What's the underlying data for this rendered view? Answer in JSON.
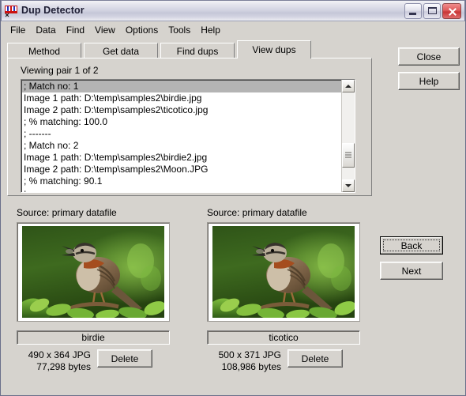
{
  "window": {
    "title": "Dup Detector",
    "icon": "dup-images-icon",
    "minimize_label": "Minimize",
    "maximize_label": "Maximize",
    "close_label": "Close"
  },
  "menu": {
    "items": [
      {
        "label": "File"
      },
      {
        "label": "Data"
      },
      {
        "label": "Find"
      },
      {
        "label": "View"
      },
      {
        "label": "Options"
      },
      {
        "label": "Tools"
      },
      {
        "label": "Help"
      }
    ]
  },
  "tabs": [
    {
      "label": "Method",
      "selected": false
    },
    {
      "label": "Get data",
      "selected": false
    },
    {
      "label": "Find dups",
      "selected": false
    },
    {
      "label": "View dups",
      "selected": true
    }
  ],
  "view_dups": {
    "viewing_label": "Viewing pair 1 of 2",
    "list": [
      {
        "text": "; Match no: 1",
        "selected": true
      },
      {
        "text": "Image 1 path: D:\\temp\\samples2\\birdie.jpg",
        "selected": false
      },
      {
        "text": "Image 2 path: D:\\temp\\samples2\\ticotico.jpg",
        "selected": false
      },
      {
        "text": "; % matching: 100.0",
        "selected": false
      },
      {
        "text": "; -------",
        "selected": false
      },
      {
        "text": "; Match no: 2",
        "selected": false
      },
      {
        "text": "Image 1 path: D:\\temp\\samples2\\birdie2.jpg",
        "selected": false
      },
      {
        "text": "Image 2 path: D:\\temp\\samples2\\Moon.JPG",
        "selected": false
      },
      {
        "text": "; % matching: 90.1",
        "selected": false
      },
      {
        "text": "; -------",
        "selected": false
      },
      {
        "text": ";",
        "selected": false
      }
    ]
  },
  "side_buttons": {
    "close": "Close",
    "help": "Help"
  },
  "nav_buttons": {
    "back": "Back",
    "next": "Next"
  },
  "panes": [
    {
      "source_label": "Source: primary datafile",
      "name": "birdie",
      "dimensions": "490 x 364 JPG",
      "bytes": "77,298 bytes",
      "delete_label": "Delete",
      "image_alt": "singing-sparrow-photo"
    },
    {
      "source_label": "Source: primary datafile",
      "name": "ticotico",
      "dimensions": "500 x 371 JPG",
      "bytes": "108,986 bytes",
      "delete_label": "Delete",
      "image_alt": "singing-sparrow-photo"
    }
  ],
  "colors": {
    "face": "#d6d3ce",
    "selection": "#b4b4b4",
    "title_text": "#1d1d33",
    "close_button": "#c83636"
  }
}
